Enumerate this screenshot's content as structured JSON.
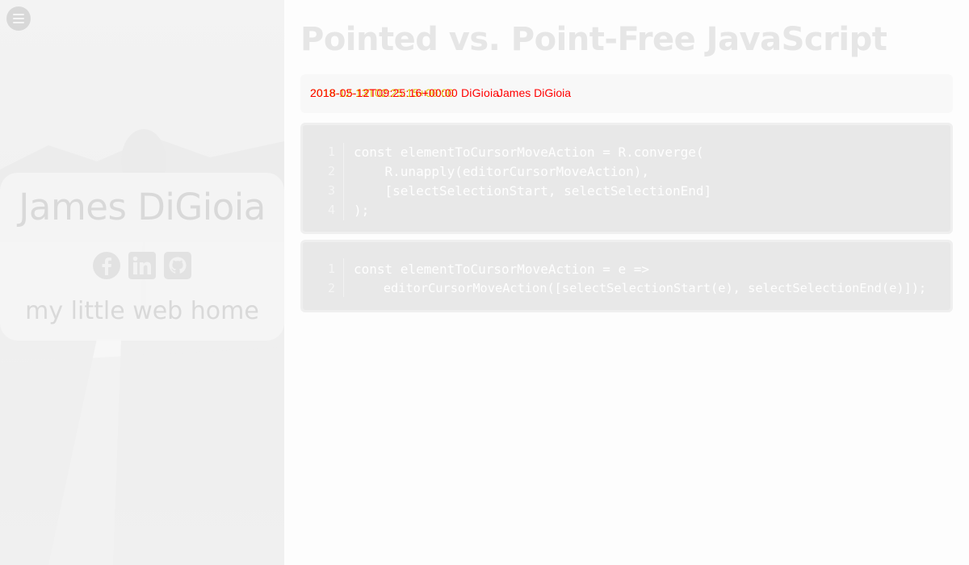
{
  "sidebar": {
    "author_name": "James DiGioia",
    "tagline": "my little web home",
    "socials": [
      {
        "name": "facebook",
        "icon": "facebook-icon"
      },
      {
        "name": "linkedin",
        "icon": "linkedin-icon"
      },
      {
        "name": "github",
        "icon": "github-icon"
      }
    ]
  },
  "post": {
    "title": "Pointed vs. Point-Free JavaScript",
    "meta": {
      "date": "2018-12-13T02:25:15+00:00",
      "author_overlap": "2018-05-12T09:25:16+00:00 DiGioia",
      "author": "James DiGioia"
    },
    "code_blocks": [
      {
        "lines": [
          {
            "num": "1",
            "text": "const elementToCursorMoveAction = R.converge("
          },
          {
            "num": "2",
            "text": "    R.unapply(editorCursorMoveAction),"
          },
          {
            "num": "3",
            "text": "    [selectSelectionStart, selectSelectionEnd]"
          },
          {
            "num": "4",
            "text": ");"
          }
        ]
      },
      {
        "lines": [
          {
            "num": "1",
            "text": "const elementToCursorMoveAction = e =>"
          },
          {
            "num": "2",
            "text": "    editorCursorMoveAction([selectSelectionStart(e), selectSelectionEnd(e)]);"
          }
        ]
      }
    ]
  },
  "colors": {
    "meta_date": "#e0c000",
    "meta_author": "#ff0000",
    "code_bg": "#e8e8e8"
  }
}
